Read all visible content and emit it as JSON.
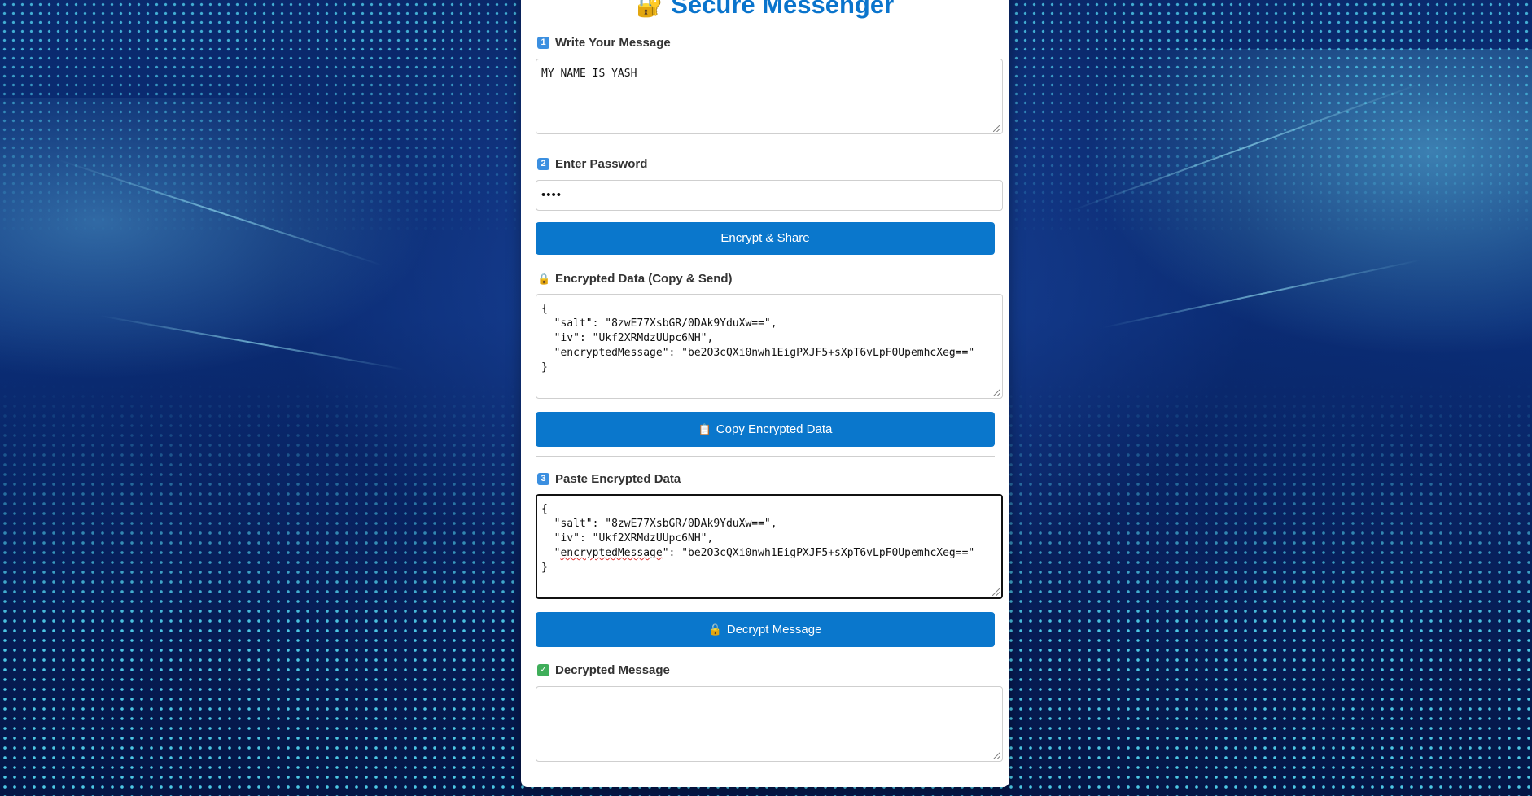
{
  "app": {
    "title": "Secure Messenger",
    "title_icon": "lock-key-icon",
    "accent_color": "#0a77cc"
  },
  "sections": {
    "write": {
      "badge": "1",
      "label": "Write Your Message",
      "value": "MY NAME IS YASH"
    },
    "password": {
      "badge": "2",
      "label": "Enter Password",
      "value": "••••"
    },
    "encrypt_button": "Encrypt & Share",
    "encrypted": {
      "icon": "lock-icon",
      "label": "Encrypted Data (Copy & Send)",
      "lines": [
        "{",
        "  \"salt\": \"8zwE77XsbGR/0DAk9YduXw==\",",
        "  \"iv\": \"Ukf2XRMdzUUpc6NH\",",
        "  \"encryptedMessage\": \"be2O3cQXi0nwh1EigPXJF5+sXpT6vLpF0UpemhcXeg==\"",
        "}"
      ]
    },
    "copy_button": {
      "icon": "clipboard-icon",
      "label": "Copy Encrypted Data"
    },
    "paste": {
      "badge": "3",
      "label": "Paste Encrypted Data",
      "lines": [
        "{",
        "  \"salt\": \"8zwE77XsbGR/0DAk9YduXw==\",",
        "  \"iv\": \"Ukf2XRMdzUUpc6NH\",",
        "  \"",
        "encryptedMessage",
        "\": \"be2O3cQXi0nwh1EigPXJF5+sXpT6vLpF0UpemhcXeg==\"",
        "}"
      ]
    },
    "decrypt_button": {
      "icon": "unlock-icon",
      "label": "Decrypt Message"
    },
    "decrypted": {
      "icon": "check-icon",
      "label": "Decrypted Message",
      "value": ""
    }
  }
}
